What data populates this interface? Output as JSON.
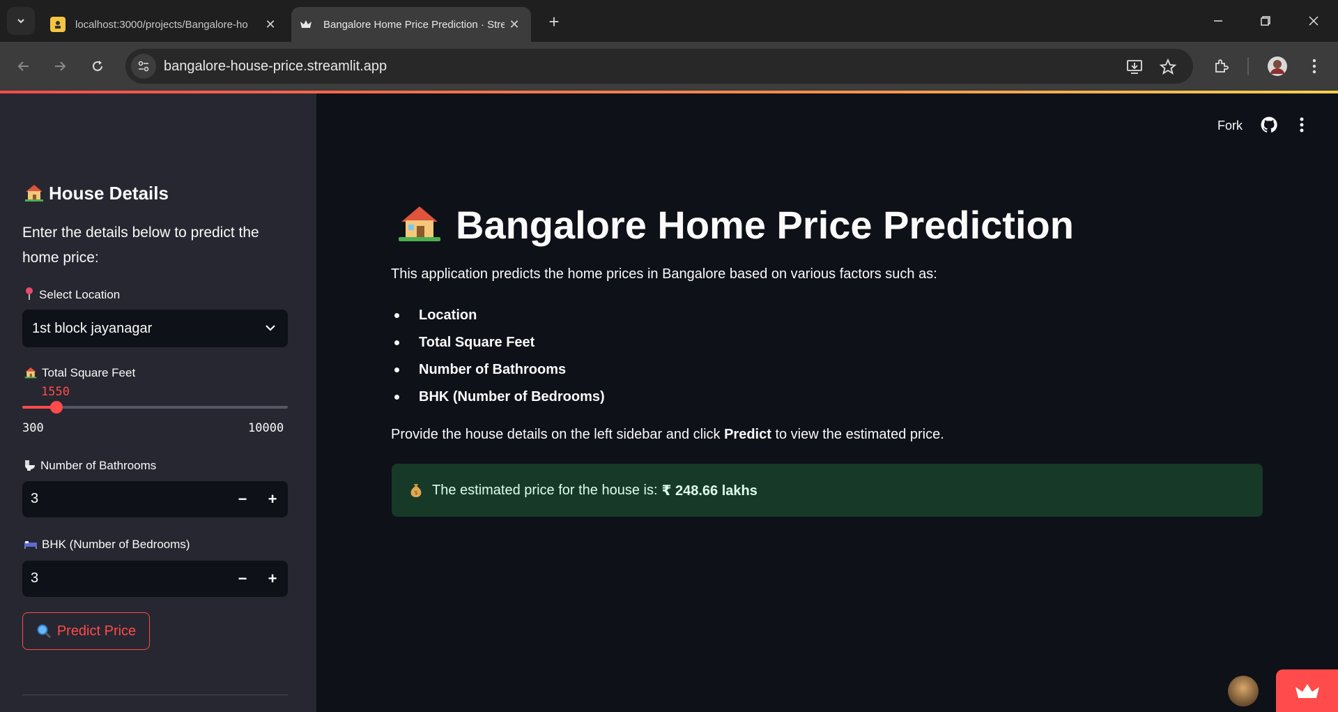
{
  "browser": {
    "tabs": [
      {
        "title": "localhost:3000/projects/Bangalore-ho",
        "active": false
      },
      {
        "title": "Bangalore Home Price Prediction · Stre",
        "active": true
      }
    ],
    "url": "bangalore-house-price.streamlit.app"
  },
  "header": {
    "fork_label": "Fork"
  },
  "sidebar": {
    "title": "House Details",
    "description": "Enter the details below to predict the home price:",
    "location": {
      "label": "Select Location",
      "value": "1st block jayanagar"
    },
    "sqft": {
      "label": "Total Square Feet",
      "value": 1550,
      "min": 300,
      "max": 10000
    },
    "bath": {
      "label": "Number of Bathrooms",
      "value": "3"
    },
    "bhk": {
      "label": "BHK (Number of Bedrooms)",
      "value": "3"
    },
    "predict_label": "Predict Price"
  },
  "main": {
    "title": "Bangalore Home Price Prediction",
    "intro": "This application predicts the home prices in Bangalore based on various factors such as:",
    "factors": [
      "Location",
      "Total Square Feet",
      "Number of Bathrooms",
      "BHK (Number of Bedrooms)"
    ],
    "provide_before": "Provide the house details on the left sidebar and click ",
    "provide_bold": "Predict",
    "provide_after": " to view the estimated price.",
    "result_text": "The estimated price for the house is:",
    "result_value": "₹ 248.66 lakhs"
  },
  "colors": {
    "accent": "#ff4b4b",
    "sidebar_bg": "#262730",
    "main_bg": "#0e1117",
    "success_bg": "#173928"
  }
}
